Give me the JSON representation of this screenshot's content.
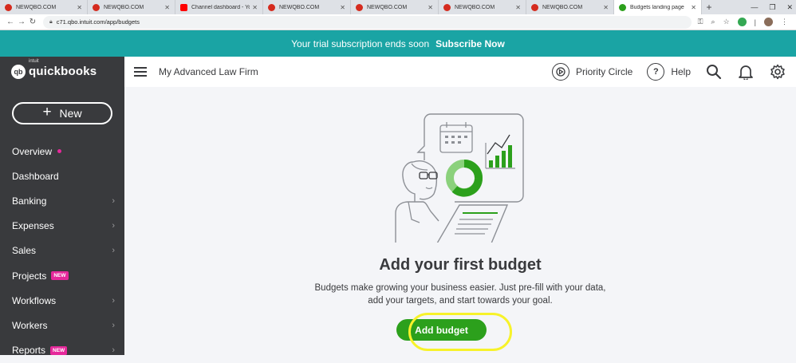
{
  "browser": {
    "tabs": [
      {
        "label": "NEWQBO.COM",
        "icon": "quickbooks-favicon",
        "active": false
      },
      {
        "label": "NEWQBO.COM",
        "icon": "quickbooks-favicon",
        "active": false
      },
      {
        "label": "Channel dashboard - YouTu",
        "icon": "youtube-favicon",
        "active": false
      },
      {
        "label": "NEWQBO.COM",
        "icon": "quickbooks-favicon",
        "active": false
      },
      {
        "label": "NEWQBO.COM",
        "icon": "quickbooks-favicon",
        "active": false
      },
      {
        "label": "NEWQBO.COM",
        "icon": "quickbooks-favicon",
        "active": false
      },
      {
        "label": "NEWQBO.COM",
        "icon": "quickbooks-favicon",
        "active": false
      },
      {
        "label": "Budgets landing page",
        "icon": "quickbooks-green-favicon",
        "active": true
      }
    ],
    "new_tab": "+",
    "url": "c71.qbo.intuit.com/app/budgets"
  },
  "banner": {
    "text": "Your trial subscription ends soon",
    "cta": "Subscribe Now",
    "bg_color": "#1aa4a4"
  },
  "brand": {
    "intuit": "intuit",
    "name": "quickbooks"
  },
  "sidebar": {
    "new_label": "New",
    "items": [
      {
        "label": "Overview",
        "dot": true,
        "badge": "",
        "chevron": false
      },
      {
        "label": "Dashboard",
        "dot": false,
        "badge": "",
        "chevron": false
      },
      {
        "label": "Banking",
        "dot": false,
        "badge": "",
        "chevron": true
      },
      {
        "label": "Expenses",
        "dot": false,
        "badge": "",
        "chevron": true
      },
      {
        "label": "Sales",
        "dot": false,
        "badge": "",
        "chevron": true
      },
      {
        "label": "Projects",
        "dot": false,
        "badge": "NEW",
        "chevron": false
      },
      {
        "label": "Workflows",
        "dot": false,
        "badge": "",
        "chevron": true
      },
      {
        "label": "Workers",
        "dot": false,
        "badge": "",
        "chevron": true
      },
      {
        "label": "Reports",
        "dot": false,
        "badge": "NEW",
        "chevron": true
      }
    ]
  },
  "header": {
    "company": "My Advanced Law Firm",
    "priority_circle": "Priority Circle",
    "help": "Help"
  },
  "main": {
    "title": "Add your first budget",
    "description_line1": "Budgets make growing your business easier. Just pre-fill with your data,",
    "description_line2": "add your targets, and start towards your goal.",
    "button": "Add budget",
    "accent_color": "#2ca01c",
    "highlight_color": "#f7f22a"
  }
}
